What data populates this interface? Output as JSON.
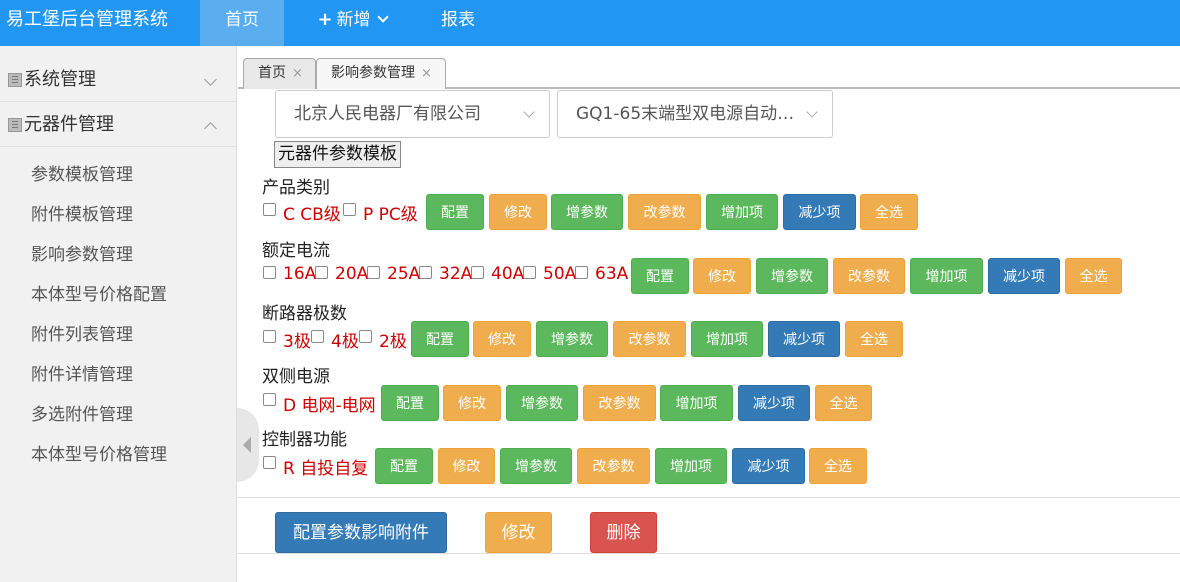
{
  "header": {
    "brand": "易工堡后台管理系统",
    "nav": {
      "home": "首页",
      "add_plus": "+",
      "add": "新增",
      "report": "报表"
    }
  },
  "sidebar": {
    "groups": [
      {
        "label": "系统管理"
      },
      {
        "label": "元器件管理"
      }
    ],
    "items": [
      "参数模板管理",
      "附件模板管理",
      "影响参数管理",
      "本体型号价格配置",
      "附件列表管理",
      "附件详情管理",
      "多选附件管理",
      "本体型号价格管理"
    ]
  },
  "tabs": [
    {
      "label": "首页",
      "close": "×"
    },
    {
      "label": "影响参数管理",
      "close": "×"
    }
  ],
  "filters": {
    "company": "北京人民电器厂有限公司",
    "product": "GQ1-65末端型双电源自动…",
    "template_button": "元器件参数模板"
  },
  "actions": {
    "config": "配置",
    "modify": "修改",
    "add_param": "增参数",
    "change_param": "改参数",
    "add_item": "增加项",
    "reduce_item": "减少项",
    "select_all": "全选"
  },
  "sections": [
    {
      "title": "产品类别",
      "options": [
        "C CB级",
        "P PC级"
      ]
    },
    {
      "title": "额定电流",
      "options": [
        "16A",
        "20A",
        "25A",
        "32A",
        "40A",
        "50A",
        "63A"
      ]
    },
    {
      "title": "断路器极数",
      "options": [
        "3极",
        "4极",
        "2极"
      ]
    },
    {
      "title": "双侧电源",
      "options": [
        "D 电网-电网"
      ]
    },
    {
      "title": "控制器功能",
      "options": [
        "R 自投自复"
      ]
    }
  ],
  "footer": {
    "config_btn": "配置参数影响附件",
    "modify_btn": "修改",
    "delete_btn": "删除"
  },
  "colors": {
    "primary": "#2196f3",
    "green": "#5cb85c",
    "orange": "#f0ad4e",
    "blue": "#337ab7",
    "red": "#d9534f",
    "option_text": "#cc0000"
  }
}
